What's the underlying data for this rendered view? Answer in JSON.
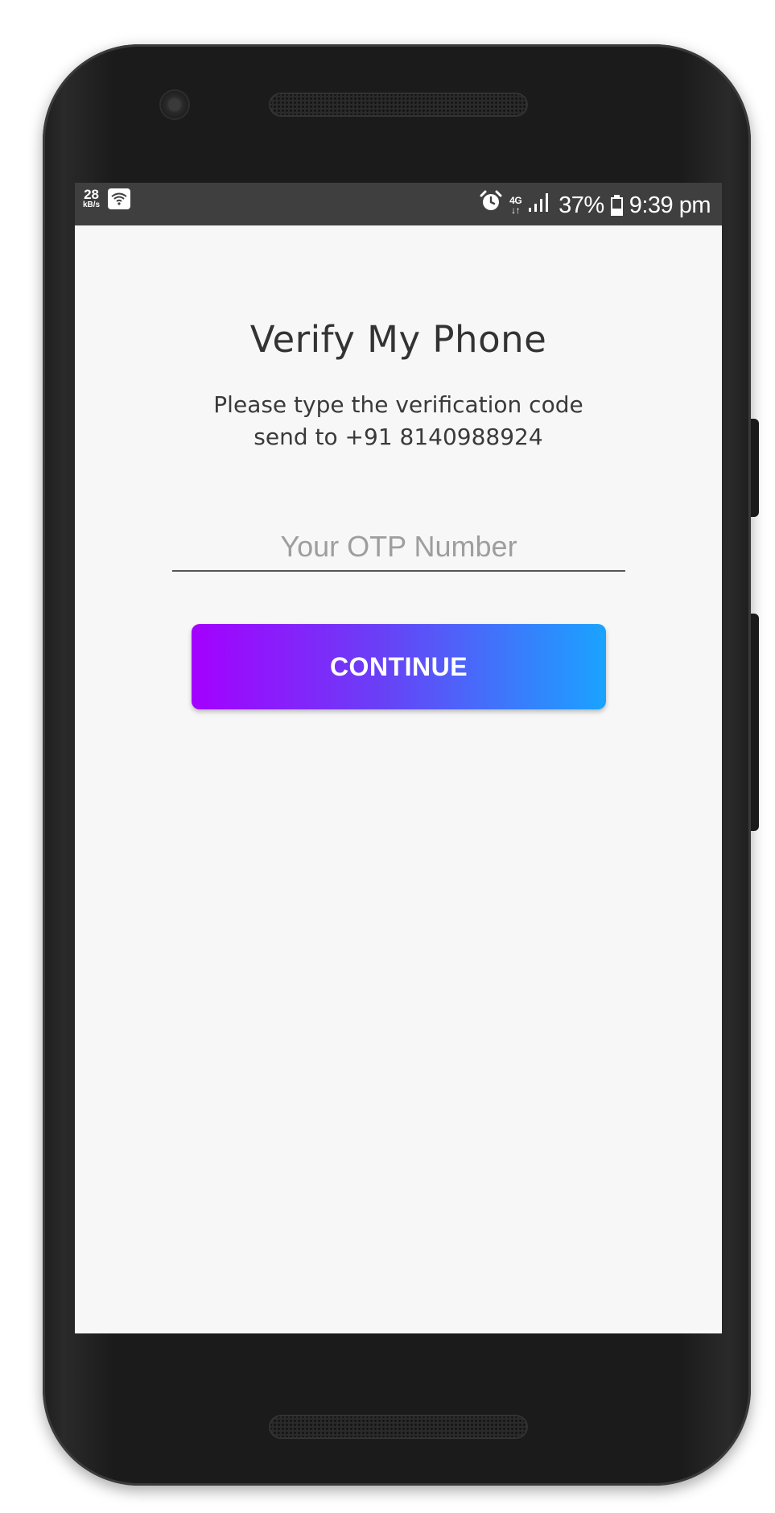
{
  "status_bar": {
    "speed_value": "28",
    "speed_unit": "kB/s",
    "network_type_top": "4G",
    "network_type_bottom": "↓↑",
    "battery_percent": "37%",
    "time": "9:39 pm",
    "icons": [
      "wifi-icon",
      "alarm-icon",
      "signal-icon",
      "battery-icon"
    ]
  },
  "screen": {
    "title": "Verify My Phone",
    "subtitle_line1": "Please type the verification code",
    "subtitle_line2": "send to +91 8140988924",
    "otp_input": {
      "placeholder": "Your OTP Number",
      "value": ""
    },
    "continue_label": "CONTINUE"
  },
  "colors": {
    "button_gradient_start": "#a400ff",
    "button_gradient_end": "#1aa3ff",
    "screen_background": "#f7f7f7",
    "status_bar_background": "#3f3f3f"
  }
}
